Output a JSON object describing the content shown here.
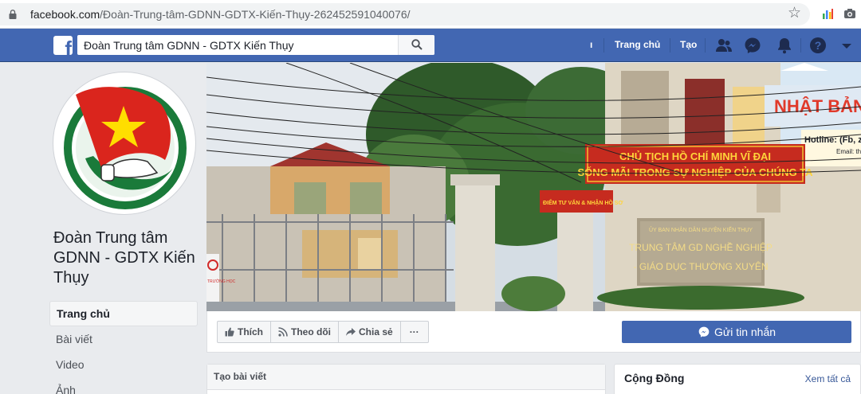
{
  "browser": {
    "url_host": "facebook.com",
    "url_path": "/Đoàn-Trung-tâm-GDNN-GDTX-Kiến-Thụy-262452591040076/"
  },
  "topbar": {
    "search_value": "Đoàn Trung tâm GDNN - GDTX Kiến Thụy",
    "profile_fragment": "ı",
    "home_label": "Trang chủ",
    "create_label": "Tạo",
    "icons": [
      "friends-icon",
      "messenger-icon",
      "notifications-icon",
      "help-icon",
      "account-menu-icon"
    ],
    "brand_color": "#4267b2"
  },
  "page": {
    "name": "Đoàn Trung tâm GDNN - GDTX Kiến Thụy",
    "avatar_icon": "doan-thanh-nien-logo",
    "nav": [
      {
        "label": "Trang chủ",
        "active": true
      },
      {
        "label": "Bài viết",
        "active": false
      },
      {
        "label": "Video",
        "active": false
      },
      {
        "label": "Ảnh",
        "active": false
      }
    ]
  },
  "cover": {
    "sign_top_line1": "CHỦ TỊCH HỒ CHÍ MINH VĨ ĐẠI",
    "sign_top_line2": "SỐNG MÃI TRONG SỰ NGHIỆP CỦA CHÚNG TA",
    "sign_gate_small": "ỦY BAN NHÂN DÂN HUYỆN KIẾN THỤY",
    "sign_gate_line1": "TRUNG TÂM GD NGHỀ NGHIỆP",
    "sign_gate_line2": "- GIÁO DỤC THƯỜNG XUYÊN",
    "sign_info": "ĐIỂM TƯ VẤN & NHẬN HỒ SƠ",
    "shop_sign": "NHẬT BẢN",
    "shop_hotline": "Hotline: (Fb, za",
    "shop_email": "Email: th",
    "side_sign": "TRƯỜNG HỌC"
  },
  "actions": {
    "like": "Thích",
    "follow": "Theo dõi",
    "share": "Chia sẻ",
    "more": "···",
    "message": "Gửi tin nhắn"
  },
  "composer": {
    "title": "Tạo bài viết"
  },
  "community": {
    "title": "Cộng Đồng",
    "see_all": "Xem tất cả"
  }
}
